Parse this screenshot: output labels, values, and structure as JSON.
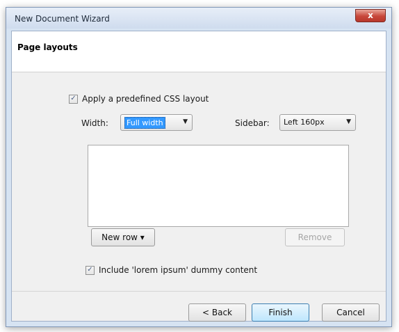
{
  "window": {
    "title": "New Document Wizard",
    "close_label": "x"
  },
  "header": {
    "title": "Page layouts"
  },
  "layout": {
    "apply_predefined": {
      "label": "Apply a predefined CSS layout",
      "checked": true
    },
    "width": {
      "label": "Width:",
      "value": "Full width"
    },
    "sidebar": {
      "label": "Sidebar:",
      "value": "Left 160px"
    },
    "rows": [],
    "new_row_label": "New row ▾",
    "remove_label": "Remove"
  },
  "dummy_content": {
    "label": "Include 'lorem ipsum' dummy content",
    "checked": true
  },
  "footer": {
    "back_label": "< Back",
    "finish_label": "Finish",
    "cancel_label": "Cancel"
  },
  "icons": {
    "checkmark": "✓",
    "dropdown": "▼"
  }
}
